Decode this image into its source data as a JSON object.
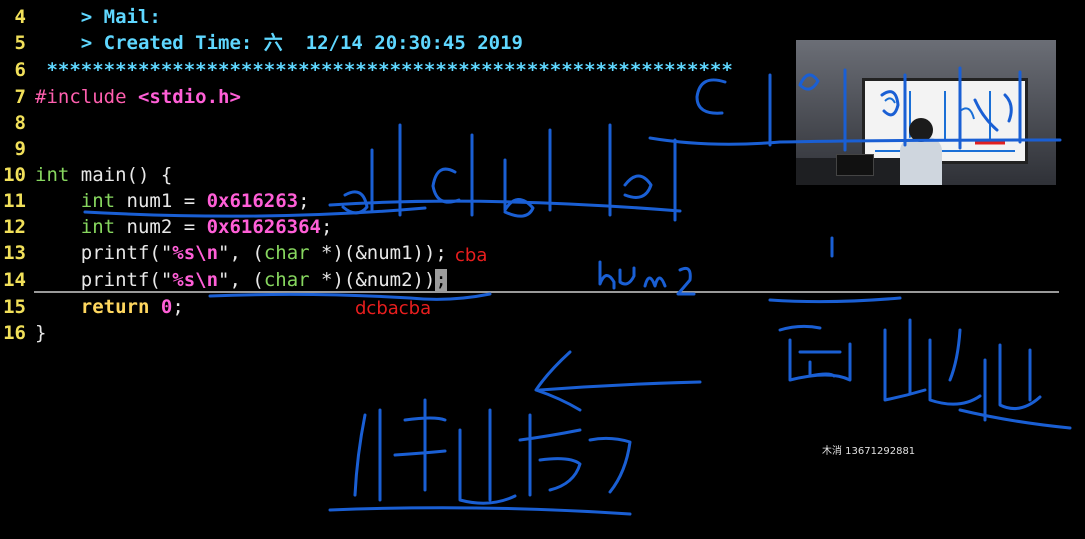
{
  "code_lines": [
    {
      "num": "4",
      "parts": [
        {
          "t": "    > Mail:",
          "c": "cyan"
        }
      ]
    },
    {
      "num": "5",
      "parts": [
        {
          "t": "    > Created Time: 六  12/14 20:30:45 2019",
          "c": "cyan"
        }
      ]
    },
    {
      "num": "6",
      "parts": [
        {
          "t": " ************************************************************",
          "c": "cyan"
        }
      ]
    },
    {
      "num": "7",
      "parts": [
        {
          "t": "#include ",
          "c": "magenta"
        },
        {
          "t": "<stdio.h>",
          "c": "pink"
        }
      ]
    },
    {
      "num": "8",
      "parts": []
    },
    {
      "num": "9",
      "parts": []
    },
    {
      "num": "10",
      "parts": [
        {
          "t": "int",
          "c": "kw"
        },
        {
          "t": " main() {",
          "c": ""
        }
      ]
    },
    {
      "num": "11",
      "parts": [
        {
          "t": "    ",
          "c": ""
        },
        {
          "t": "int",
          "c": "kw"
        },
        {
          "t": " num1 = ",
          "c": ""
        },
        {
          "t": "0x616263",
          "c": "pink"
        },
        {
          "t": ";",
          "c": ""
        }
      ]
    },
    {
      "num": "12",
      "parts": [
        {
          "t": "    ",
          "c": ""
        },
        {
          "t": "int",
          "c": "kw"
        },
        {
          "t": " num2 = ",
          "c": ""
        },
        {
          "t": "0x61626364",
          "c": "pink"
        },
        {
          "t": ";",
          "c": ""
        }
      ]
    },
    {
      "num": "13",
      "parts": [
        {
          "t": "    printf(\"",
          "c": ""
        },
        {
          "t": "%s\\n",
          "c": "pink"
        },
        {
          "t": "\", (",
          "c": ""
        },
        {
          "t": "char",
          "c": "kw"
        },
        {
          "t": " *)(&num1));",
          "c": ""
        }
      ]
    },
    {
      "num": "14",
      "parts": [
        {
          "t": "    printf(\"",
          "c": ""
        },
        {
          "t": "%s\\n",
          "c": "pink"
        },
        {
          "t": "\", (",
          "c": ""
        },
        {
          "t": "char",
          "c": "kw"
        },
        {
          "t": " *)(&num2))",
          "c": ""
        },
        {
          "t": ";",
          "c": "cursor"
        }
      ]
    },
    {
      "num": "15",
      "parts": [
        {
          "t": "    ",
          "c": ""
        },
        {
          "t": "return",
          "c": "yellow"
        },
        {
          "t": " ",
          "c": ""
        },
        {
          "t": "0",
          "c": "pink"
        },
        {
          "t": ";",
          "c": ""
        }
      ]
    },
    {
      "num": "16",
      "parts": [
        {
          "t": "}",
          "c": ""
        }
      ]
    }
  ],
  "annotations": {
    "red_note_line13": "cba",
    "red_note_line15": "dcbacba"
  },
  "watermark": "木消 13671292881"
}
